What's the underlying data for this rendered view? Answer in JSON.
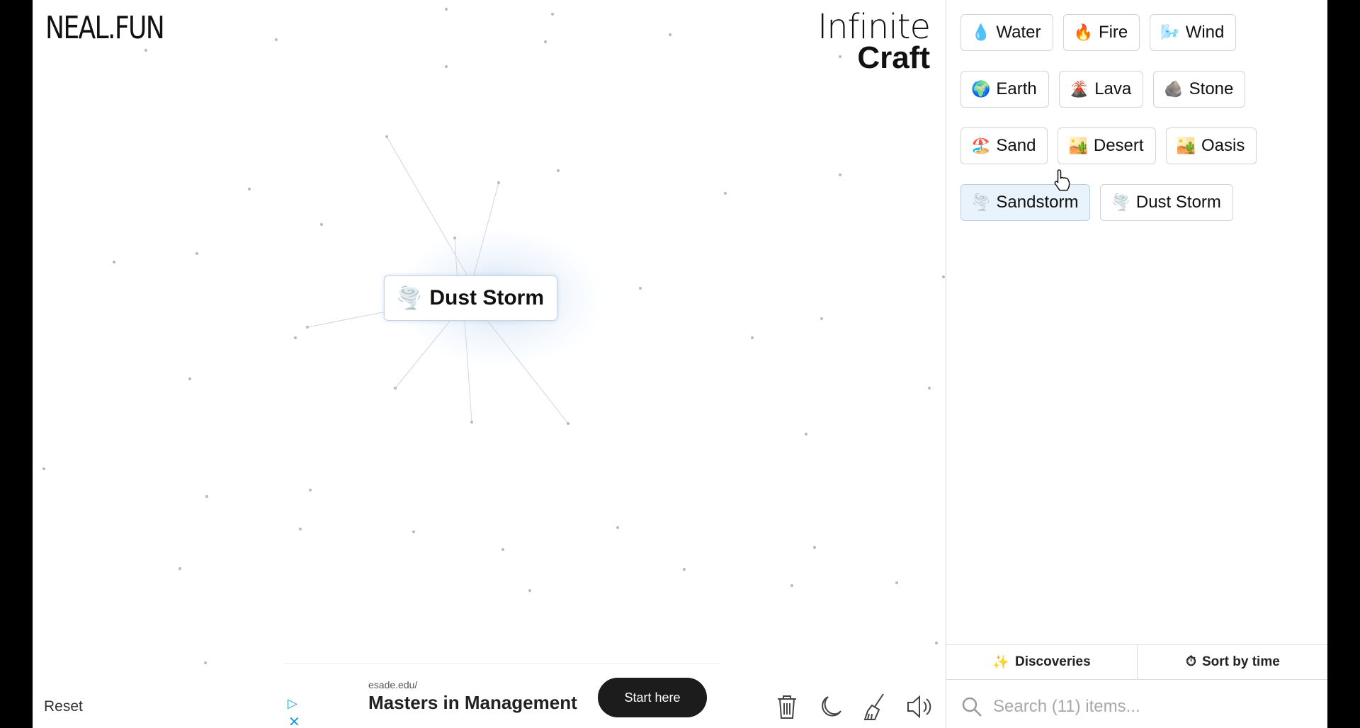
{
  "header": {
    "site_logo": "NEAL.FUN",
    "app_title_line1": "Infinite",
    "app_title_line2": "Craft"
  },
  "canvas": {
    "item": {
      "emoji": "🌪️",
      "label": "Dust Storm"
    },
    "reset_label": "Reset"
  },
  "ad": {
    "url": "esade.edu/",
    "title": "Masters in Management",
    "cta": "Start here"
  },
  "tools": [
    "trash-icon",
    "moon-icon",
    "broom-icon",
    "speaker-icon"
  ],
  "sidebar": {
    "items": [
      {
        "emoji": "💧",
        "label": "Water"
      },
      {
        "emoji": "🔥",
        "label": "Fire"
      },
      {
        "emoji": "🌬️",
        "label": "Wind"
      },
      {
        "emoji": "🌍",
        "label": "Earth"
      },
      {
        "emoji": "🌋",
        "label": "Lava"
      },
      {
        "emoji": "🪨",
        "label": "Stone"
      },
      {
        "emoji": "🏖️",
        "label": "Sand"
      },
      {
        "emoji": "🏜️",
        "label": "Desert"
      },
      {
        "emoji": "🏜️",
        "label": "Oasis"
      },
      {
        "emoji": "🌪️",
        "label": "Sandstorm",
        "active": true
      },
      {
        "emoji": "🌪️",
        "label": "Dust Storm"
      }
    ],
    "tabs": {
      "discoveries": "Discoveries",
      "sort": "Sort by time"
    },
    "search": {
      "placeholder": "Search (11) items..."
    }
  }
}
